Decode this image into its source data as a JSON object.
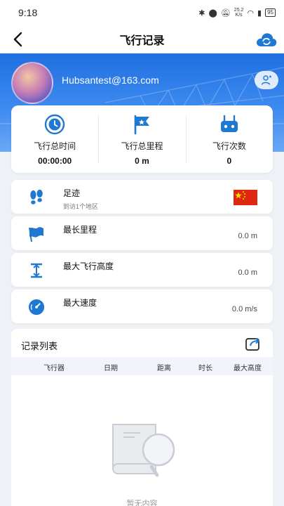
{
  "status": {
    "time": "9:18",
    "speed_value": "25.2",
    "speed_unit": "K/s",
    "battery": "95"
  },
  "header": {
    "title": "飞行记录"
  },
  "profile": {
    "email": "Hubsantest@163.com"
  },
  "stats": [
    {
      "label": "飞行总时间",
      "value": "00:00:00"
    },
    {
      "label": "飞行总里程",
      "value": "0 m"
    },
    {
      "label": "飞行次数",
      "value": "0"
    }
  ],
  "footprint": {
    "title": "足迹",
    "subtitle": "到访1个地区"
  },
  "max_distance": {
    "title": "最长里程",
    "value": "0.0 m"
  },
  "max_altitude": {
    "title": "最大飞行高度",
    "value": "0.0 m"
  },
  "max_speed": {
    "title": "最大速度",
    "value": "0.0 m/s"
  },
  "records": {
    "title": "记录列表",
    "columns": [
      "飞行器",
      "日期",
      "距离",
      "时长",
      "最大高度"
    ],
    "empty_text": "暂无内容"
  },
  "colors": {
    "accent": "#1f78d1",
    "hero": "#2f7fe8",
    "flag": "#de2910"
  }
}
